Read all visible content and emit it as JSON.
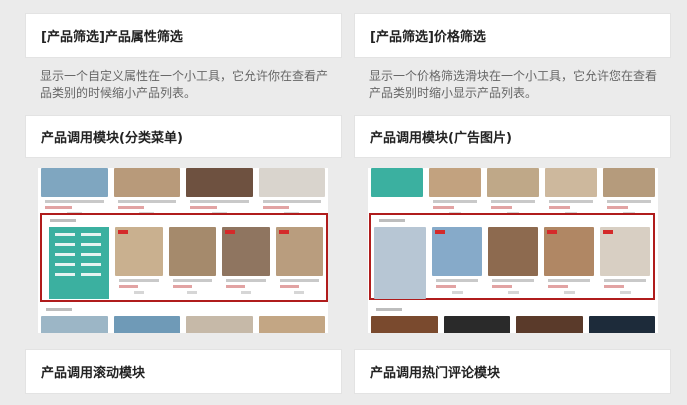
{
  "cards": {
    "attr_filter": {
      "title": "[产品筛选]产品属性筛选",
      "desc": "显示一个自定义属性在一个小工具，它允许你在查看产品类别的时候缩小产品列表。"
    },
    "price_filter": {
      "title": "[产品筛选]价格筛选",
      "desc": "显示一个价格筛选滑块在一个小工具，它允许您在查看产品类别时缩小显示产品列表。"
    },
    "category_menu": {
      "title": "产品调用模块(分类菜单)"
    },
    "ad_image": {
      "title": "产品调用模块(广告图片)"
    },
    "scroll": {
      "title": "产品调用滚动模块"
    },
    "hot_comments": {
      "title": "产品调用热门评论模块"
    }
  },
  "colors": {
    "highlight": "#b01c1c",
    "menu": "#3bb0a0",
    "price": "#d42a2a"
  }
}
